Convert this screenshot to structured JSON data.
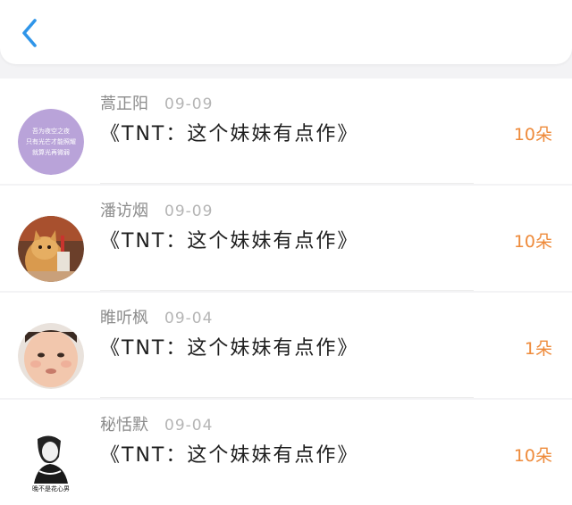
{
  "header": {
    "back_icon": "chevron-left-icon",
    "accent": "#2f95e9"
  },
  "rows": [
    {
      "name": "蒿正阳",
      "date": "09-09",
      "title": "《TNT：这个妹妹有点作》",
      "amount": "10朵",
      "avatar_text": [
        "吾为夜空之夜",
        "只有光芒才能照耀",
        "就算光再微弱"
      ]
    },
    {
      "name": "潘访烟",
      "date": "09-09",
      "title": "《TNT：这个妹妹有点作》",
      "amount": "10朵"
    },
    {
      "name": "睢听枫",
      "date": "09-04",
      "title": "《TNT：这个妹妹有点作》",
      "amount": "1朵"
    },
    {
      "name": "秘恬默",
      "date": "09-04",
      "title": "《TNT：这个妹妹有点作》",
      "amount": "10朵",
      "avatar_text": [
        "晚不是花心男"
      ]
    }
  ],
  "colors": {
    "amount": "#ee8a3a",
    "name": "#8c8c8c",
    "date": "#b5b5b5"
  }
}
